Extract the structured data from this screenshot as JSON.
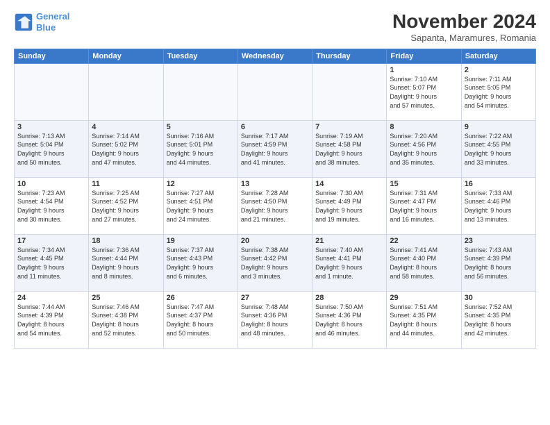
{
  "logo": {
    "line1": "General",
    "line2": "Blue"
  },
  "title": "November 2024",
  "subtitle": "Sapanta, Maramures, Romania",
  "weekdays": [
    "Sunday",
    "Monday",
    "Tuesday",
    "Wednesday",
    "Thursday",
    "Friday",
    "Saturday"
  ],
  "weeks": [
    [
      {
        "day": "",
        "info": ""
      },
      {
        "day": "",
        "info": ""
      },
      {
        "day": "",
        "info": ""
      },
      {
        "day": "",
        "info": ""
      },
      {
        "day": "",
        "info": ""
      },
      {
        "day": "1",
        "info": "Sunrise: 7:10 AM\nSunset: 5:07 PM\nDaylight: 9 hours\nand 57 minutes."
      },
      {
        "day": "2",
        "info": "Sunrise: 7:11 AM\nSunset: 5:05 PM\nDaylight: 9 hours\nand 54 minutes."
      }
    ],
    [
      {
        "day": "3",
        "info": "Sunrise: 7:13 AM\nSunset: 5:04 PM\nDaylight: 9 hours\nand 50 minutes."
      },
      {
        "day": "4",
        "info": "Sunrise: 7:14 AM\nSunset: 5:02 PM\nDaylight: 9 hours\nand 47 minutes."
      },
      {
        "day": "5",
        "info": "Sunrise: 7:16 AM\nSunset: 5:01 PM\nDaylight: 9 hours\nand 44 minutes."
      },
      {
        "day": "6",
        "info": "Sunrise: 7:17 AM\nSunset: 4:59 PM\nDaylight: 9 hours\nand 41 minutes."
      },
      {
        "day": "7",
        "info": "Sunrise: 7:19 AM\nSunset: 4:58 PM\nDaylight: 9 hours\nand 38 minutes."
      },
      {
        "day": "8",
        "info": "Sunrise: 7:20 AM\nSunset: 4:56 PM\nDaylight: 9 hours\nand 35 minutes."
      },
      {
        "day": "9",
        "info": "Sunrise: 7:22 AM\nSunset: 4:55 PM\nDaylight: 9 hours\nand 33 minutes."
      }
    ],
    [
      {
        "day": "10",
        "info": "Sunrise: 7:23 AM\nSunset: 4:54 PM\nDaylight: 9 hours\nand 30 minutes."
      },
      {
        "day": "11",
        "info": "Sunrise: 7:25 AM\nSunset: 4:52 PM\nDaylight: 9 hours\nand 27 minutes."
      },
      {
        "day": "12",
        "info": "Sunrise: 7:27 AM\nSunset: 4:51 PM\nDaylight: 9 hours\nand 24 minutes."
      },
      {
        "day": "13",
        "info": "Sunrise: 7:28 AM\nSunset: 4:50 PM\nDaylight: 9 hours\nand 21 minutes."
      },
      {
        "day": "14",
        "info": "Sunrise: 7:30 AM\nSunset: 4:49 PM\nDaylight: 9 hours\nand 19 minutes."
      },
      {
        "day": "15",
        "info": "Sunrise: 7:31 AM\nSunset: 4:47 PM\nDaylight: 9 hours\nand 16 minutes."
      },
      {
        "day": "16",
        "info": "Sunrise: 7:33 AM\nSunset: 4:46 PM\nDaylight: 9 hours\nand 13 minutes."
      }
    ],
    [
      {
        "day": "17",
        "info": "Sunrise: 7:34 AM\nSunset: 4:45 PM\nDaylight: 9 hours\nand 11 minutes."
      },
      {
        "day": "18",
        "info": "Sunrise: 7:36 AM\nSunset: 4:44 PM\nDaylight: 9 hours\nand 8 minutes."
      },
      {
        "day": "19",
        "info": "Sunrise: 7:37 AM\nSunset: 4:43 PM\nDaylight: 9 hours\nand 6 minutes."
      },
      {
        "day": "20",
        "info": "Sunrise: 7:38 AM\nSunset: 4:42 PM\nDaylight: 9 hours\nand 3 minutes."
      },
      {
        "day": "21",
        "info": "Sunrise: 7:40 AM\nSunset: 4:41 PM\nDaylight: 9 hours\nand 1 minute."
      },
      {
        "day": "22",
        "info": "Sunrise: 7:41 AM\nSunset: 4:40 PM\nDaylight: 8 hours\nand 58 minutes."
      },
      {
        "day": "23",
        "info": "Sunrise: 7:43 AM\nSunset: 4:39 PM\nDaylight: 8 hours\nand 56 minutes."
      }
    ],
    [
      {
        "day": "24",
        "info": "Sunrise: 7:44 AM\nSunset: 4:39 PM\nDaylight: 8 hours\nand 54 minutes."
      },
      {
        "day": "25",
        "info": "Sunrise: 7:46 AM\nSunset: 4:38 PM\nDaylight: 8 hours\nand 52 minutes."
      },
      {
        "day": "26",
        "info": "Sunrise: 7:47 AM\nSunset: 4:37 PM\nDaylight: 8 hours\nand 50 minutes."
      },
      {
        "day": "27",
        "info": "Sunrise: 7:48 AM\nSunset: 4:36 PM\nDaylight: 8 hours\nand 48 minutes."
      },
      {
        "day": "28",
        "info": "Sunrise: 7:50 AM\nSunset: 4:36 PM\nDaylight: 8 hours\nand 46 minutes."
      },
      {
        "day": "29",
        "info": "Sunrise: 7:51 AM\nSunset: 4:35 PM\nDaylight: 8 hours\nand 44 minutes."
      },
      {
        "day": "30",
        "info": "Sunrise: 7:52 AM\nSunset: 4:35 PM\nDaylight: 8 hours\nand 42 minutes."
      }
    ]
  ]
}
